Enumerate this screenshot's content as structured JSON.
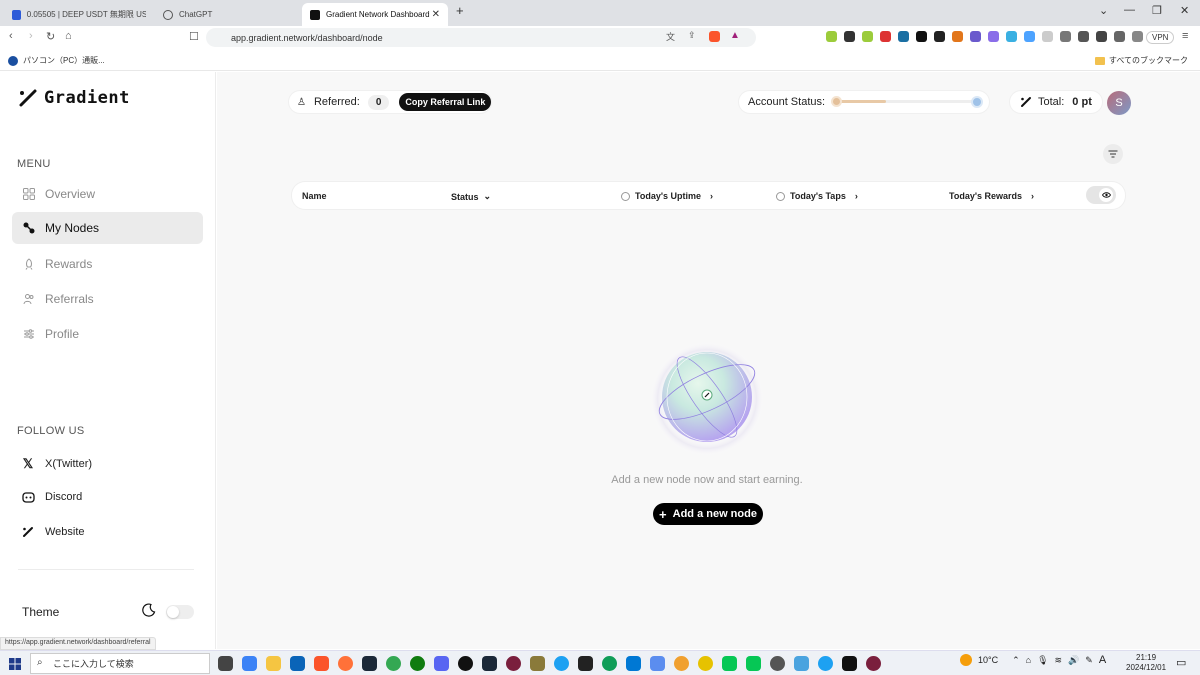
{
  "browser": {
    "tabs": [
      {
        "title": "0.05505 | DEEP USDT 無期限 USDT...",
        "active": false
      },
      {
        "title": "ChatGPT",
        "active": false
      },
      {
        "title": "Gradient Network Dashboard",
        "active": true
      }
    ],
    "url": "app.gradient.network/dashboard/node",
    "vpn_label": "VPN",
    "bookmark_left": "パソコン（PC）通販...",
    "bookmark_right": "すべてのブックマーク",
    "status_url": "https://app.gradient.network/dashboard/referral"
  },
  "sidebar": {
    "logo": "Gradient",
    "menu_heading": "MENU",
    "items": [
      {
        "label": "Overview",
        "icon": "grid-icon"
      },
      {
        "label": "My Nodes",
        "icon": "nodes-icon",
        "active": true
      },
      {
        "label": "Rewards",
        "icon": "rocket-icon"
      },
      {
        "label": "Referrals",
        "icon": "users-icon"
      },
      {
        "label": "Profile",
        "icon": "sliders-icon"
      }
    ],
    "follow_heading": "FOLLOW US",
    "follow": [
      {
        "label": "X(Twitter)",
        "icon": "x-icon"
      },
      {
        "label": "Discord",
        "icon": "discord-icon"
      },
      {
        "label": "Website",
        "icon": "gradient-icon"
      }
    ],
    "theme_label": "Theme"
  },
  "header": {
    "referred_label": "Referred:",
    "referred_count": "0",
    "copy_referral": "Copy Referral Link",
    "account_status_label": "Account Status:",
    "account_status_level": 0.35,
    "total_label": "Total:",
    "total_value": "0 pt",
    "avatar_initial": "S"
  },
  "table": {
    "columns": [
      "Name",
      "Status",
      "Today's Uptime",
      "Today's Taps",
      "Today's Rewards"
    ]
  },
  "empty_state": {
    "message": "Add a new node now and start earning.",
    "button": "Add a new node"
  },
  "taskbar": {
    "search_placeholder": "ここに入力して検索",
    "weather": "10°C",
    "ime": "A",
    "time": "21:19",
    "date": "2024/12/01"
  },
  "colors": {
    "accent": "#000000",
    "active_nav_bg": "#ebebeb",
    "main_bg": "#f8f8f8"
  }
}
